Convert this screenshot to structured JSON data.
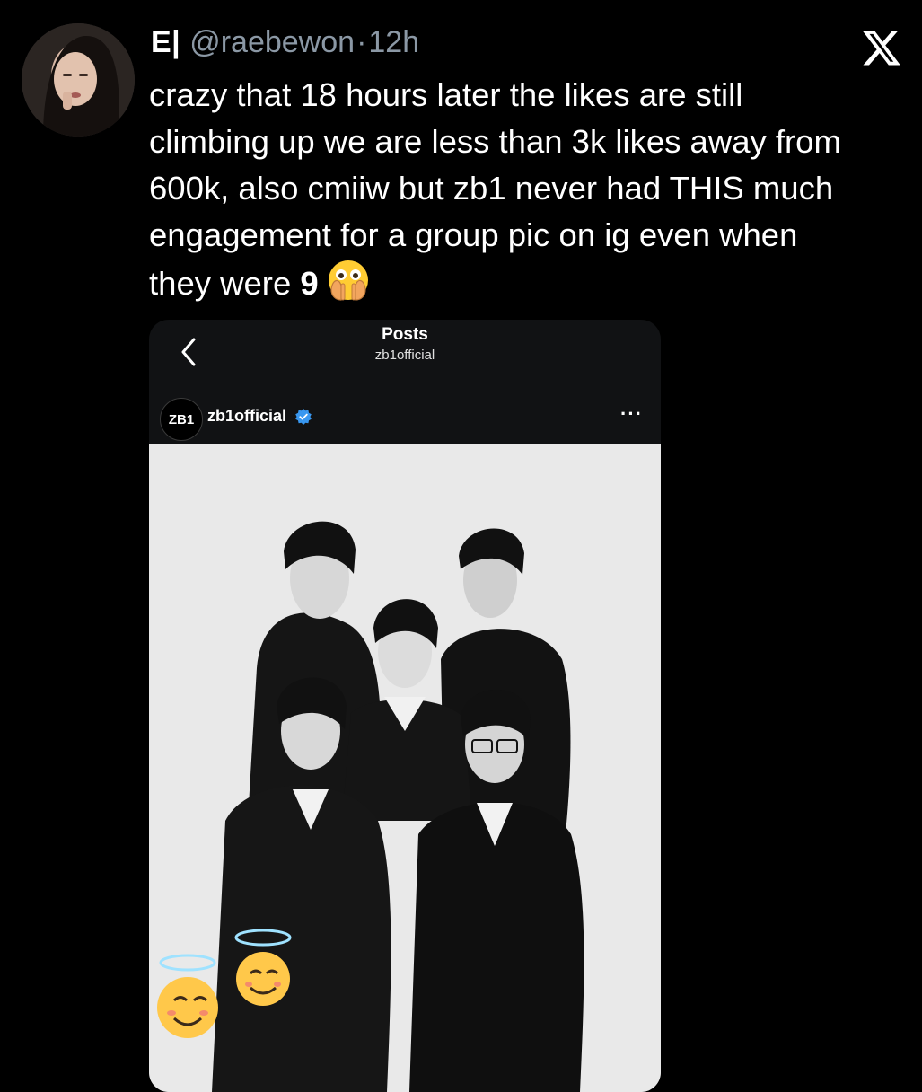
{
  "tweet": {
    "display_name": "E|",
    "handle": "@raebewon",
    "dot": "·",
    "time": "12h",
    "text_main": "crazy that 18 hours later the likes are still\nclimbing up we are less than 3k likes away from\n600k, also cmiiw but zb1 never had THIS much\nengagement for a group pic on ig even when\nthey were ",
    "text_bold": "9",
    "emoji": "face-with-open-eyes-and-hand-over-mouth"
  },
  "instagram": {
    "title": "Posts",
    "subtitle": "zb1official",
    "account_avatar_text": "ZB1",
    "username": "zb1official",
    "more": "···"
  },
  "icons": {
    "platform_logo": "x-logo-icon",
    "back": "chevron-left-icon",
    "verified": "verified-badge-icon",
    "stickers": "smiling-face-with-halo-icon"
  },
  "colors": {
    "background": "#000000",
    "secondary_text": "#8b98a5",
    "verified_blue": "#3897f0",
    "photo_background": "#e9e9e9"
  }
}
